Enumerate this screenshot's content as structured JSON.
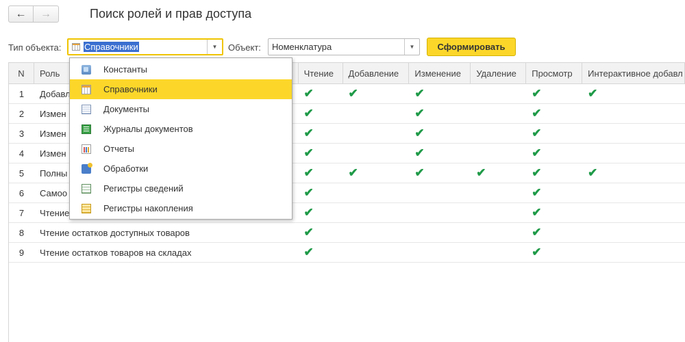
{
  "nav": {
    "back_icon": "←",
    "forward_icon": "→"
  },
  "page_title": "Поиск ролей и прав доступа",
  "filters": {
    "object_type_label": "Тип объекта:",
    "object_type_value": "Справочники",
    "object_label": "Объект:",
    "object_value": "Номенклатура",
    "dropdown_arrow": "▼"
  },
  "generate_button": "Сформировать",
  "table": {
    "columns": [
      "N",
      "Роль",
      "Чтение",
      "Добавление",
      "Изменение",
      "Удаление",
      "Просмотр",
      "Интерактивное добавл"
    ],
    "check_mark": "✔",
    "rows": [
      {
        "n": "1",
        "role": "Добавл",
        "rights": [
          true,
          true,
          true,
          false,
          true,
          true
        ]
      },
      {
        "n": "2",
        "role": "Измен",
        "rights": [
          true,
          false,
          true,
          false,
          true,
          false
        ]
      },
      {
        "n": "3",
        "role": "Измен",
        "rights": [
          true,
          false,
          true,
          false,
          true,
          false
        ]
      },
      {
        "n": "4",
        "role": "Измен",
        "rights": [
          true,
          false,
          true,
          false,
          true,
          false
        ]
      },
      {
        "n": "5",
        "role": "Полны",
        "rights": [
          true,
          true,
          true,
          true,
          true,
          true
        ]
      },
      {
        "n": "6",
        "role": "Самоо",
        "rights": [
          true,
          false,
          false,
          false,
          true,
          false
        ]
      },
      {
        "n": "7",
        "role": "Чтение",
        "rights": [
          true,
          false,
          false,
          false,
          true,
          false
        ]
      },
      {
        "n": "8",
        "role": "Чтение остатков доступных товаров",
        "rights": [
          true,
          false,
          false,
          false,
          true,
          false
        ]
      },
      {
        "n": "9",
        "role": "Чтение остатков товаров на складах",
        "rights": [
          true,
          false,
          false,
          false,
          true,
          false
        ]
      }
    ]
  },
  "dropdown": {
    "items": [
      {
        "label": "Константы",
        "icon": "constants-icon"
      },
      {
        "label": "Справочники",
        "icon": "catalogs-icon"
      },
      {
        "label": "Документы",
        "icon": "documents-icon"
      },
      {
        "label": "Журналы документов",
        "icon": "document-journals-icon"
      },
      {
        "label": "Отчеты",
        "icon": "reports-icon"
      },
      {
        "label": "Обработки",
        "icon": "data-processors-icon"
      },
      {
        "label": "Регистры сведений",
        "icon": "information-registers-icon"
      },
      {
        "label": "Регистры накопления",
        "icon": "accumulation-registers-icon"
      }
    ],
    "selected_index": 1
  },
  "colors": {
    "accent": "#fcd72a",
    "check": "#1f9a48",
    "selection": "#3a6fd0"
  }
}
